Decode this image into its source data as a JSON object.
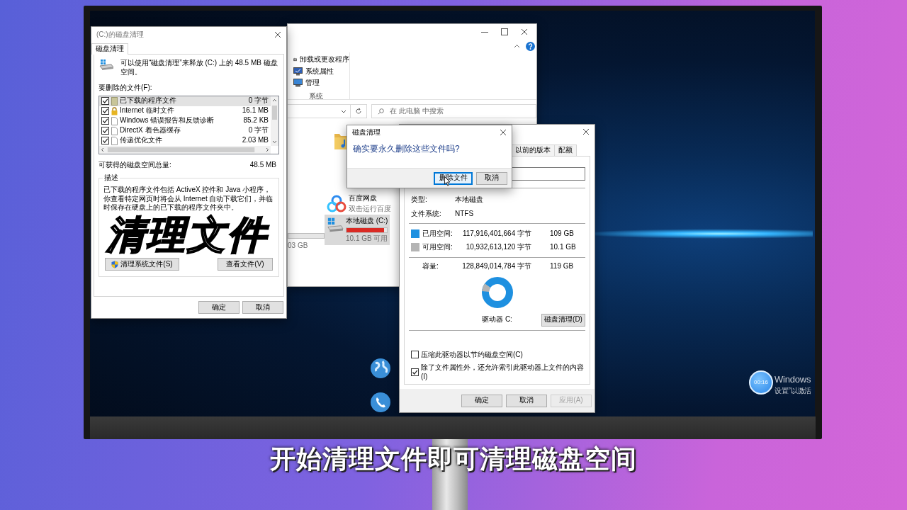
{
  "cleanup_window": {
    "title": "(C:)的磁盘清理",
    "tabs": [
      {
        "label": "磁盘清理",
        "selected": true
      }
    ],
    "intro": "可以使用“磁盘清理”来释放 (C:) 上的 48.5 MB 磁盘空间。",
    "files_label": "要删除的文件(F):",
    "files": [
      {
        "kind": "program",
        "name": "已下载的程序文件",
        "size": "0 字节",
        "checked": true,
        "selected": true
      },
      {
        "kind": "locked",
        "name": "Internet 临时文件",
        "size": "16.1 MB",
        "checked": true,
        "selected": false
      },
      {
        "kind": "file",
        "name": "Windows 错误报告和反馈诊断",
        "size": "85.2 KB",
        "checked": true,
        "selected": false
      },
      {
        "kind": "file",
        "name": "DirectX 着色器缓存",
        "size": "0 字节",
        "checked": true,
        "selected": false
      },
      {
        "kind": "file",
        "name": "传递优化文件",
        "size": "2.03 MB",
        "checked": true,
        "selected": false
      }
    ],
    "total_label": "可获得的磁盘空间总量:",
    "total_value": "48.5 MB",
    "description": {
      "legend": "描述",
      "text": "已下载的程序文件包括 ActiveX 控件和 Java 小程序，你查看特定网页时将会从 Internet 自动下载它们，并临时保存在硬盘上的已下载的程序文件夹中。"
    },
    "overlay_title": "清理文件",
    "actions": [
      {
        "kind": "shield",
        "label": "清理系统文件(S)"
      },
      {
        "kind": "plain",
        "label": "查看文件(V)"
      }
    ],
    "buttons": [
      "确定",
      "取消"
    ]
  },
  "explorer_window": {
    "ribbon_items": [
      {
        "kind": "uninstall",
        "label": "卸载或更改程序"
      },
      {
        "kind": "properties",
        "label": "系统属性"
      },
      {
        "kind": "manage",
        "label": "管理"
      }
    ],
    "ribbon_group": "系统",
    "search_placeholder": "在 此电脑 中搜索",
    "items": [
      {
        "kind": "app",
        "name": "百度网盘",
        "detail": "双击运行百度",
        "selected": false
      },
      {
        "kind": "drive",
        "name": "本地磁盘 (C:)",
        "detail": "10.1 GB 可用",
        "level": 0.92,
        "selected": true
      }
    ],
    "partial_drive": {
      "detail": "03 GB"
    }
  },
  "properties_window": {
    "tabs": [
      {
        "label": "以前的版本",
        "selected": false
      },
      {
        "label": "配额",
        "selected": false
      }
    ],
    "info": [
      {
        "label": "类型:",
        "value": "本地磁盘"
      },
      {
        "label": "文件系统:",
        "value": "NTFS"
      }
    ],
    "usage": [
      {
        "label": "已用空间:",
        "bytes": "117,916,401,664 字节",
        "size": "109 GB",
        "color": "#1e90e0"
      },
      {
        "label": "可用空间:",
        "bytes": "10,932,613,120 字节",
        "size": "10.1 GB",
        "color": "#b4b4b4"
      }
    ],
    "capacity": {
      "label": "容量:",
      "bytes": "128,849,014,784 字节",
      "size": "119 GB"
    },
    "drive_label": "驱动器 C:",
    "cleanup_button": "磁盘清理(D)",
    "options": [
      {
        "label": "压缩此驱动器以节约磁盘空间(C)",
        "checked": false
      },
      {
        "label": "除了文件属性外，还允许索引此驱动器上文件的内容(I)",
        "checked": true
      }
    ],
    "buttons": [
      {
        "label": "确定",
        "disabled": false
      },
      {
        "label": "取消",
        "disabled": false
      },
      {
        "label": "应用(A)",
        "disabled": true
      }
    ]
  },
  "confirm_dialog": {
    "title": "磁盘清理",
    "message": "确实要永久删除这些文件吗?",
    "buttons": [
      {
        "label": "删除文件",
        "default": true
      },
      {
        "label": "取消",
        "default": false
      }
    ]
  },
  "activation_notice": [
    "Windows",
    "设置”以激活"
  ],
  "timer": "00:16",
  "caption": "开始清理文件即可清理磁盘空间"
}
